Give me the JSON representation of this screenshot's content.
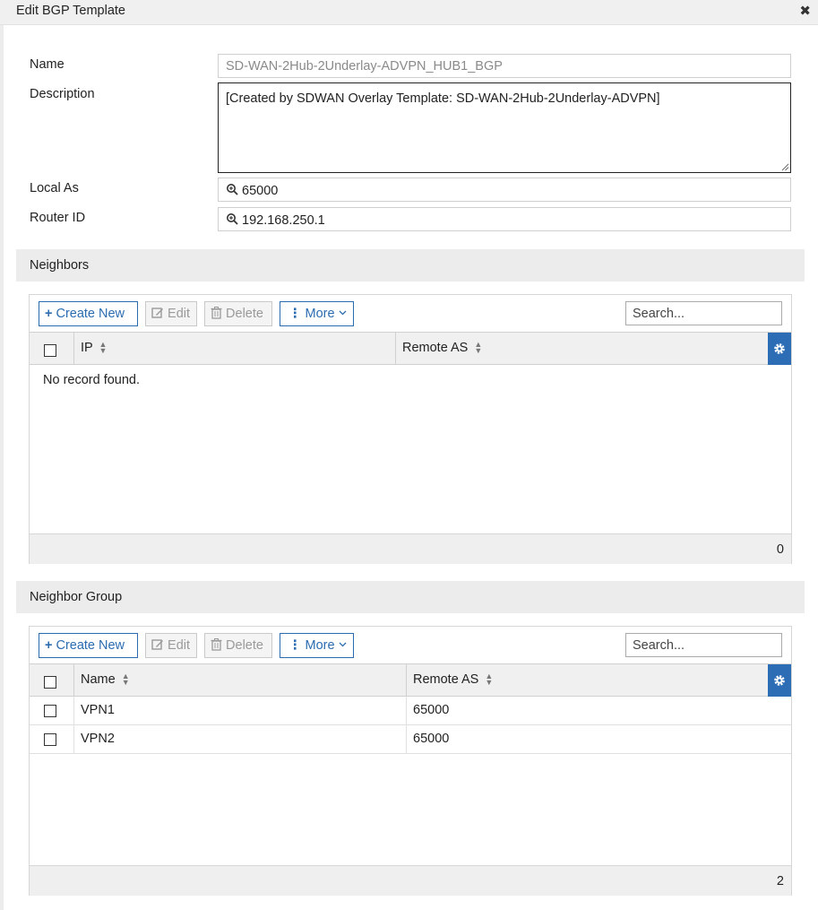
{
  "dialog": {
    "title": "Edit BGP Template",
    "close_icon": "✖"
  },
  "form": {
    "name_label": "Name",
    "name_value": "SD-WAN-2Hub-2Underlay-ADVPN_HUB1_BGP",
    "description_label": "Description",
    "description_value": "[Created by SDWAN Overlay Template: SD-WAN-2Hub-2Underlay-ADVPN]",
    "local_as_label": "Local As",
    "local_as_value": "65000",
    "router_id_label": "Router ID",
    "router_id_value": "192.168.250.1"
  },
  "neighbors": {
    "section_title": "Neighbors",
    "toolbar": {
      "create_new": "Create New",
      "edit": "Edit",
      "delete": "Delete",
      "more": "More",
      "search_placeholder": "Search..."
    },
    "columns": [
      "IP",
      "Remote AS"
    ],
    "empty_message": "No record found.",
    "count": "0"
  },
  "neighbor_group": {
    "section_title": "Neighbor Group",
    "toolbar": {
      "create_new": "Create New",
      "edit": "Edit",
      "delete": "Delete",
      "more": "More",
      "search_placeholder": "Search..."
    },
    "columns": [
      "Name",
      "Remote AS"
    ],
    "rows": [
      {
        "name": "VPN1",
        "remote_as": "65000"
      },
      {
        "name": "VPN2",
        "remote_as": "65000"
      }
    ],
    "count": "2"
  },
  "colors": {
    "accent": "#2b6cb0",
    "gear_bg": "#2d6db5",
    "section_bg": "#ececec"
  }
}
